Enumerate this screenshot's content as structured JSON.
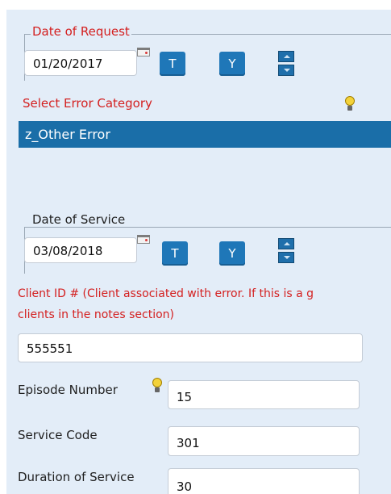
{
  "date_of_request": {
    "legend": "Date of Request",
    "value": "01/20/2017",
    "today_button": "T",
    "yesterday_button": "Y"
  },
  "error_category": {
    "label": "Select Error Category",
    "selected": "z_Other Error"
  },
  "date_of_service": {
    "legend": "Date of Service",
    "value": "03/08/2018",
    "today_button": "T",
    "yesterday_button": "Y"
  },
  "client_id": {
    "label_line1": "Client ID # (Client associated with error. If this is a g",
    "label_line2": "clients in the notes section)",
    "value": "555551"
  },
  "episode_number": {
    "label": "Episode Number",
    "value": "15"
  },
  "service_code": {
    "label": "Service Code",
    "value": "301"
  },
  "duration_of_service": {
    "label": "Duration of Service",
    "value": "30"
  },
  "colors": {
    "panel_bg": "#e3edf8",
    "label_red": "#d42020",
    "button_blue": "#1f77b8",
    "selected_bar": "#1a6ea8"
  }
}
